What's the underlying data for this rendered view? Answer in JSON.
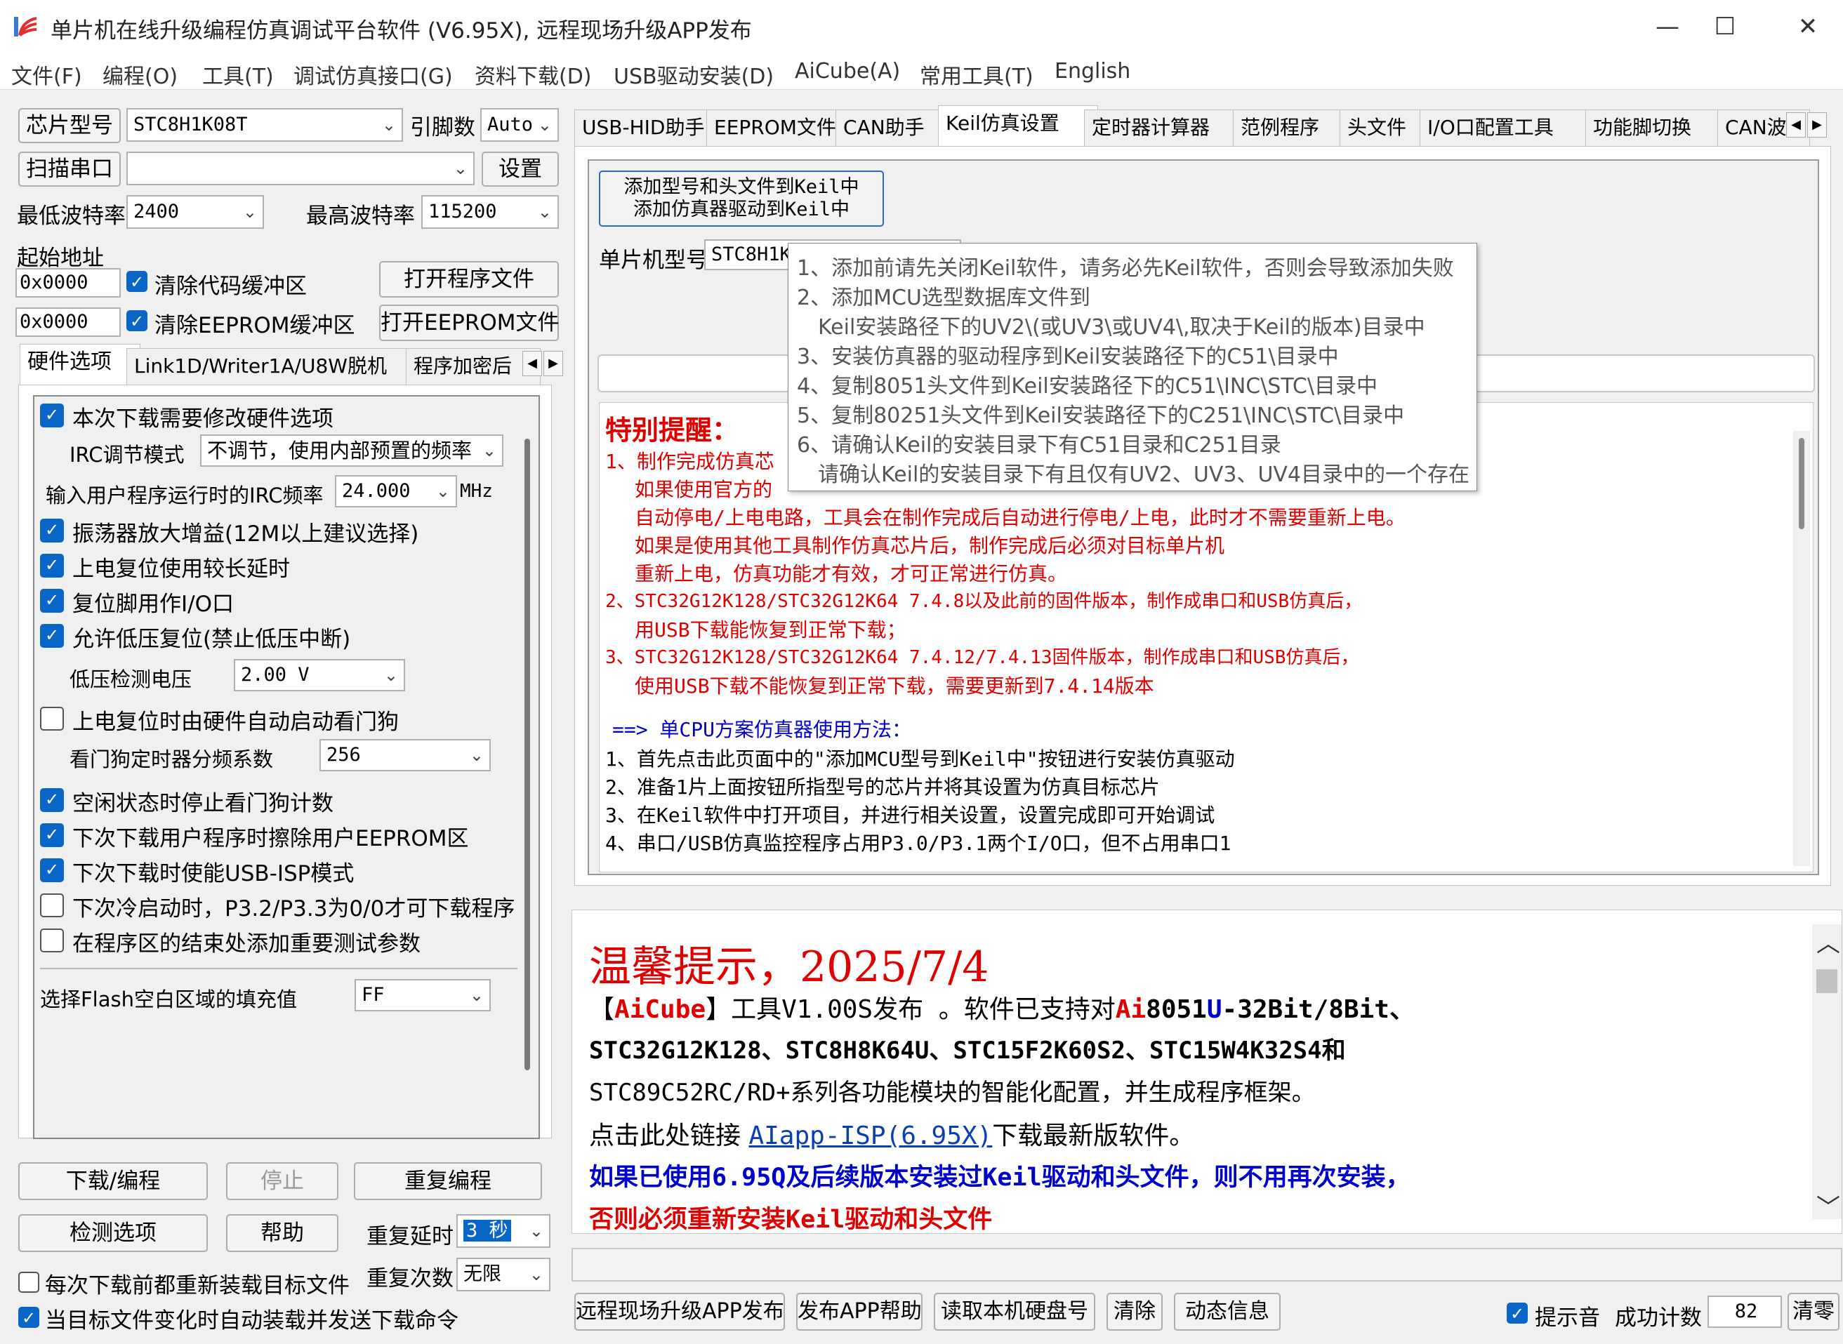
{
  "window": {
    "title": "单片机在线升级编程仿真调试平台软件 (V6.95X), 远程现场升级APP发布",
    "minimize": "—",
    "maximize": "☐",
    "close": "✕"
  },
  "menu": [
    "文件(F)",
    "编程(O)",
    "工具(T)",
    "调试仿真接口(G)",
    "资料下载(D)",
    "USB驱动安装(D)",
    "AiCube(A)",
    "常用工具(T)",
    "English"
  ],
  "left": {
    "chip_label": "芯片型号",
    "chip_value": "STC8H1K08T",
    "pins_label": "引脚数",
    "pins_value": "Auto",
    "scan_button": "扫描串口",
    "port_value": "",
    "settings_button": "设置",
    "min_baud_label": "最低波特率",
    "min_baud_value": "2400",
    "max_baud_label": "最高波特率",
    "max_baud_value": "115200",
    "start_addr_label": "起始地址",
    "addr1": "0x0000",
    "clear_code_label": "清除代码缓冲区",
    "open_prog_button": "打开程序文件",
    "addr2": "0x0000",
    "clear_eeprom_label": "清除EEPROM缓冲区",
    "open_eeprom_button": "打开EEPROM文件",
    "tabs": [
      "硬件选项",
      "Link1D/Writer1A/U8W脱机",
      "程序加密后"
    ],
    "hw": {
      "opt_modify": "本次下载需要修改硬件选项",
      "irc_mode_label": "IRC调节模式",
      "irc_mode_value": "不调节，使用内部预置的频率",
      "irc_freq_label": "输入用户程序运行时的IRC频率",
      "irc_freq_value": "24.000",
      "irc_unit": "MHz",
      "opt_osc": "振荡器放大增益(12M以上建议选择)",
      "opt_reset_delay": "上电复位使用较长延时",
      "opt_reset_io": "复位脚用作I/O口",
      "opt_lvr": "允许低压复位(禁止低压中断)",
      "lv_label": "低压检测电压",
      "lv_value": "2.00 V",
      "opt_wdt": "上电复位时由硬件自动启动看门狗",
      "wdt_div_label": "看门狗定时器分频系数",
      "wdt_div_value": "256",
      "opt_idle_wdt": "空闲状态时停止看门狗计数",
      "opt_erase_eeprom": "下次下载用户程序时擦除用户EEPROM区",
      "opt_usb_isp": "下次下载时使能USB-ISP模式",
      "opt_cold": "下次冷启动时，P3.2/P3.3为0/0才可下载程序",
      "opt_test_param": "在程序区的结束处添加重要测试参数",
      "fill_label": "选择Flash空白区域的填充值",
      "fill_value": "FF"
    },
    "download_button": "下载/编程",
    "stop_button": "停止",
    "reprogram_button": "重复编程",
    "check_button": "检测选项",
    "help_button": "帮助",
    "repeat_delay_label": "重复延时",
    "repeat_delay_value": "3 秒",
    "repeat_count_label": "重复次数",
    "repeat_count_value": "无限",
    "reload_label": "每次下载前都重新装载目标文件",
    "autoload_label": "当目标文件变化时自动装载并发送下载命令"
  },
  "right": {
    "tabs": [
      "USB-HID助手",
      "EEPROM文件",
      "CAN助手",
      "Keil仿真设置",
      "定时器计算器",
      "范例程序",
      "头文件",
      "I/O口配置工具",
      "功能脚切换",
      "CAN波特"
    ],
    "keil_button_line1": "添加型号和头文件到Keil中",
    "keil_button_line2": "添加仿真器驱动到Keil中",
    "mcu_label": "单片机型号",
    "mcu_value": "STC8H1K",
    "tooltip": [
      "1、添加前请先关闭Keil软件，请务必先Keil软件，否则会导致添加失败",
      "2、添加MCU选型数据库文件到",
      "Keil安装路径下的UV2\\(或UV3\\或UV4\\,取决于Keil的版本)目录中",
      "3、安装仿真器的驱动程序到Keil安装路径下的C51\\目录中",
      "4、复制8051头文件到Keil安装路径下的C51\\INC\\STC\\目录中",
      "5、复制80251头文件到Keil安装路径下的C251\\INC\\STC\\目录中",
      "6、请确认Keil的安装目录下有C51目录和C251目录",
      "请确认Keil的安装目录下有且仅有UV2、UV3、UV4目录中的一个存在"
    ],
    "notice_title": "特别提醒：",
    "notice_lines": [
      "1、制作完成仿真芯",
      "如果使用官方的",
      "自动停电/上电电路，工具会在制作完成后自动进行停电/上电，此时才不需要重新上电。",
      "如果是使用其他工具制作仿真芯片后，制作完成后必须对目标单片机",
      "重新上电，仿真功能才有效，才可正常进行仿真。",
      "2、STC32G12K128/STC32G12K64  7.4.8以及此前的固件版本，制作成串口和USB仿真后，",
      "用USB下载能恢复到正常下载；",
      "3、STC32G12K128/STC32G12K64  7.4.12/7.4.13固件版本，制作成串口和USB仿真后，",
      "使用USB下载不能恢复到正常下载，需要更新到7.4.14版本"
    ],
    "method_title": "==> 单CPU方案仿真器使用方法：",
    "method_lines": [
      "1、首先点击此页面中的\"添加MCU型号到Keil中\"按钮进行安装仿真驱动",
      "2、准备1片上面按钮所指型号的芯片并将其设置为仿真目标芯片",
      "3、在Keil软件中打开项目，并进行相关设置，设置完成即可开始调试",
      "4、串口/USB仿真监控程序占用P3.0/P3.1两个I/O口，但不占用串口1"
    ],
    "tip_title": "温馨提示，2025/7/4",
    "tip_l1_a": "【",
    "tip_l1_b": "AiCube",
    "tip_l1_c": "】工具V1.00S发布 。软件已支持对",
    "tip_l1_d": "Ai",
    "tip_l1_e": "8051",
    "tip_l1_f": "U",
    "tip_l1_g": "-32Bit/8Bit、",
    "tip_l2": "STC32G12K128、STC8H8K64U、STC15F2K60S2、STC15W4K32S4和",
    "tip_l3": "STC89C52RC/RD+系列各功能模块的智能化配置，并生成程序框架。",
    "tip_l4_a": "点击此处链接 ",
    "tip_l4_link": "AIapp-ISP(6.95X)",
    "tip_l4_c": "下载最新版软件。",
    "tip_l5": "如果已使用6.95Q及后续版本安装过Keil驱动和头文件，则不用再次安装，",
    "tip_l6": "否则必须重新安装Keil驱动和头文件"
  },
  "bottom": {
    "remote_button": "远程现场升级APP发布",
    "app_help_button": "发布APP帮助",
    "read_disk_button": "读取本机硬盘号",
    "clear_button": "清除",
    "dynamic_button": "动态信息",
    "sound_label": "提示音",
    "success_label": "成功计数",
    "success_value": "82",
    "clear2_button": "清零"
  },
  "colors": {
    "accent": "#0a66c6",
    "red": "#e00000",
    "blue": "#0000cc",
    "link": "#0a3fb0"
  }
}
